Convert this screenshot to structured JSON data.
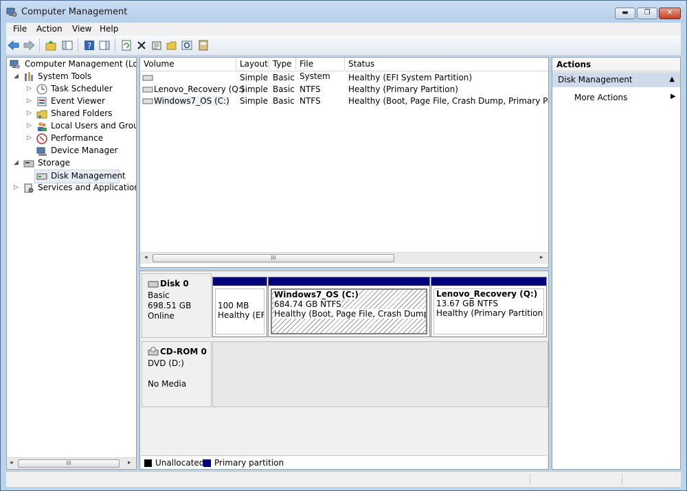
{
  "window": {
    "title": "Computer Management",
    "buttons": {
      "minimize": "▬",
      "maximize": "❐",
      "close": "✕"
    }
  },
  "menu": [
    "File",
    "Action",
    "View",
    "Help"
  ],
  "toolbar_icons": [
    "back-arrow-icon",
    "forward-arrow-icon",
    "up-folder-icon",
    "show-hide-console-tree-icon",
    "help-icon",
    "show-hide-action-pane-icon",
    "refresh-icon",
    "delete-icon",
    "properties-icon",
    "open-icon",
    "rescan-disks-icon",
    "help-topics-icon"
  ],
  "tree": [
    {
      "label": "Computer Management (Local",
      "level": 0,
      "expander": ""
    },
    {
      "label": "System Tools",
      "level": 1,
      "expander": "◢"
    },
    {
      "label": "Task Scheduler",
      "level": 2,
      "expander": "▷"
    },
    {
      "label": "Event Viewer",
      "level": 2,
      "expander": "▷"
    },
    {
      "label": "Shared Folders",
      "level": 2,
      "expander": "▷"
    },
    {
      "label": "Local Users and Groups",
      "level": 2,
      "expander": "▷"
    },
    {
      "label": "Performance",
      "level": 2,
      "expander": "▷"
    },
    {
      "label": "Device Manager",
      "level": 2,
      "expander": ""
    },
    {
      "label": "Storage",
      "level": 1,
      "expander": "◢"
    },
    {
      "label": "Disk Management",
      "level": 2,
      "expander": "",
      "selected": true
    },
    {
      "label": "Services and Applications",
      "level": 1,
      "expander": "▷"
    }
  ],
  "volumes": {
    "columns": [
      "Volume",
      "Layout",
      "Type",
      "File System",
      "Status"
    ],
    "rows": [
      [
        "",
        "Simple",
        "Basic",
        "",
        "Healthy (EFI System Partition)"
      ],
      [
        "Lenovo_Recovery (Q:)",
        "Simple",
        "Basic",
        "NTFS",
        "Healthy (Primary Partition)"
      ],
      [
        "Windows7_OS (C:)",
        "Simple",
        "Basic",
        "NTFS",
        "Healthy (Boot, Page File, Crash Dump, Primary Partition"
      ]
    ]
  },
  "scroll_glyphs": {
    "left": "◂",
    "right": "▸",
    "grip": "III"
  },
  "disk0": {
    "name": "Disk 0",
    "type": "Basic",
    "size": "698.51 GB",
    "state": "Online",
    "partitions": [
      {
        "name": "",
        "size": "100 MB",
        "status": "Healthy (EFI"
      },
      {
        "name": "Windows7_OS  (C:)",
        "size": "684.74 GB NTFS",
        "status": "Healthy (Boot, Page File, Crash Dump, Prir"
      },
      {
        "name": "Lenovo_Recovery  (Q:)",
        "size": "13.67 GB NTFS",
        "status": "Healthy (Primary Partition)"
      }
    ]
  },
  "cdrom0": {
    "name": "CD-ROM 0",
    "type": "DVD (D:)",
    "state": "No Media"
  },
  "legend": [
    {
      "label": "Unallocated",
      "color": "#000000"
    },
    {
      "label": "Primary partition",
      "color": "#00007a"
    }
  ],
  "actions": {
    "header": "Actions",
    "section": "Disk Management",
    "section_arrow": "▲",
    "items": [
      {
        "label": "More Actions",
        "arrow": "▶"
      }
    ]
  }
}
